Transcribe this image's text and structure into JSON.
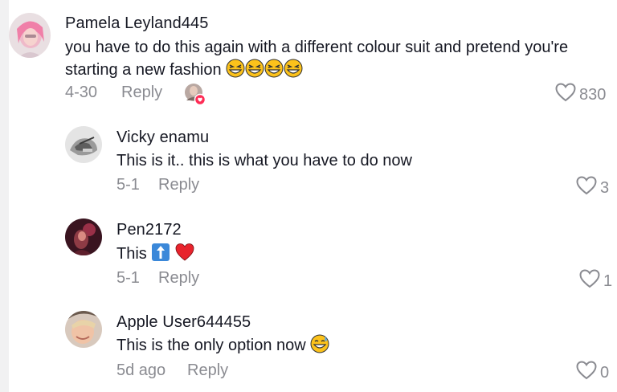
{
  "comments": [
    {
      "username": "Pamela Leyland445",
      "text_line1": "you have to do this again with a different colour suit and pretend you're",
      "text_line2": "starting a new fashion",
      "emojis": [
        "grinning-squint-tears",
        "grinning-squint-tears",
        "grinning-squint-tears",
        "grinning-squint-tears"
      ],
      "date": "4-30",
      "reply_label": "Reply",
      "likes": "830",
      "liked_by_creator": true
    },
    {
      "username": "Vicky enamu",
      "text": "This is it.. this is what you have to do now",
      "date": "5-1",
      "reply_label": "Reply",
      "likes": "3"
    },
    {
      "username": "Pen2172",
      "text": "This",
      "emojis": [
        "up-arrow-box",
        "red-heart"
      ],
      "date": "5-1",
      "reply_label": "Reply",
      "likes": "1"
    },
    {
      "username": "Apple User644455",
      "text": "This is the only option now",
      "emojis": [
        "grinning-sweat"
      ],
      "date": "5d ago",
      "reply_label": "Reply",
      "likes": "0"
    }
  ],
  "colors": {
    "text": "#161823",
    "meta": "#8a8b91",
    "rail": "#f1f1f2",
    "badge": "#fe2c55"
  }
}
